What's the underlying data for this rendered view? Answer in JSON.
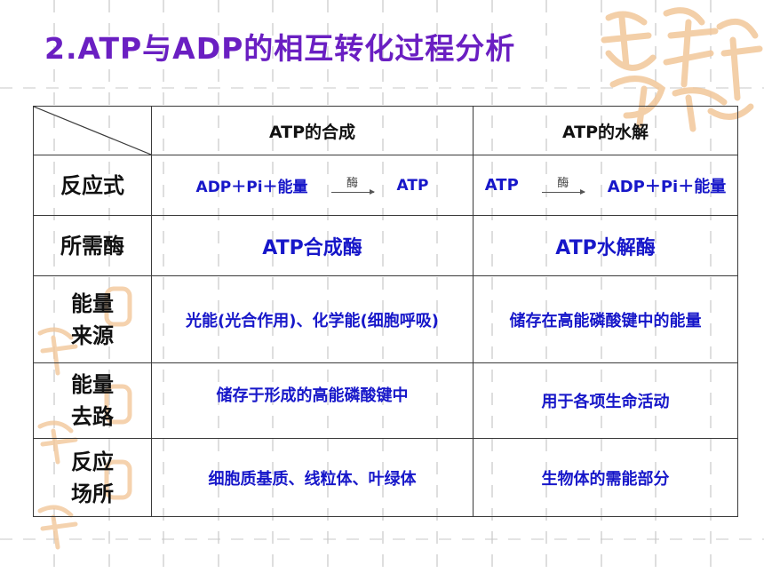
{
  "title": "2.ATP与ADP的相互转化过程分析",
  "table": {
    "headers": [
      "",
      "ATP的合成",
      "ATP的水解"
    ],
    "rows": [
      {
        "label": "反应式",
        "synthesis": {
          "left": "ADP＋Pi＋能量",
          "enzyme": "酶",
          "right": "ATP"
        },
        "hydrolysis": {
          "left": "ATP",
          "enzyme": "酶",
          "right": "ADP＋Pi＋能量"
        }
      },
      {
        "label": "所需酶",
        "synthesis": "ATP合成酶",
        "hydrolysis": "ATP水解酶"
      },
      {
        "label_line1": "能量",
        "label_line2": "来源",
        "synthesis": "光能(光合作用)、化学能(细胞呼吸)",
        "hydrolysis": "储存在高能磷酸键中的能量"
      },
      {
        "label_line1": "能量",
        "label_line2": "去路",
        "synthesis": "储存于形成的高能磷酸键中",
        "hydrolysis": "用于各项生命活动"
      },
      {
        "label_line1": "反应",
        "label_line2": "场所",
        "synthesis": "细胞质基质、线粒体、叶绿体",
        "hydrolysis": "生物体的需能部分"
      }
    ]
  },
  "colors": {
    "title": "#6a1fc2",
    "cell_text": "#1717c9",
    "watermark": "#f2c79a"
  },
  "decor": {
    "watermark_seal": "seal-watermark-icon"
  }
}
